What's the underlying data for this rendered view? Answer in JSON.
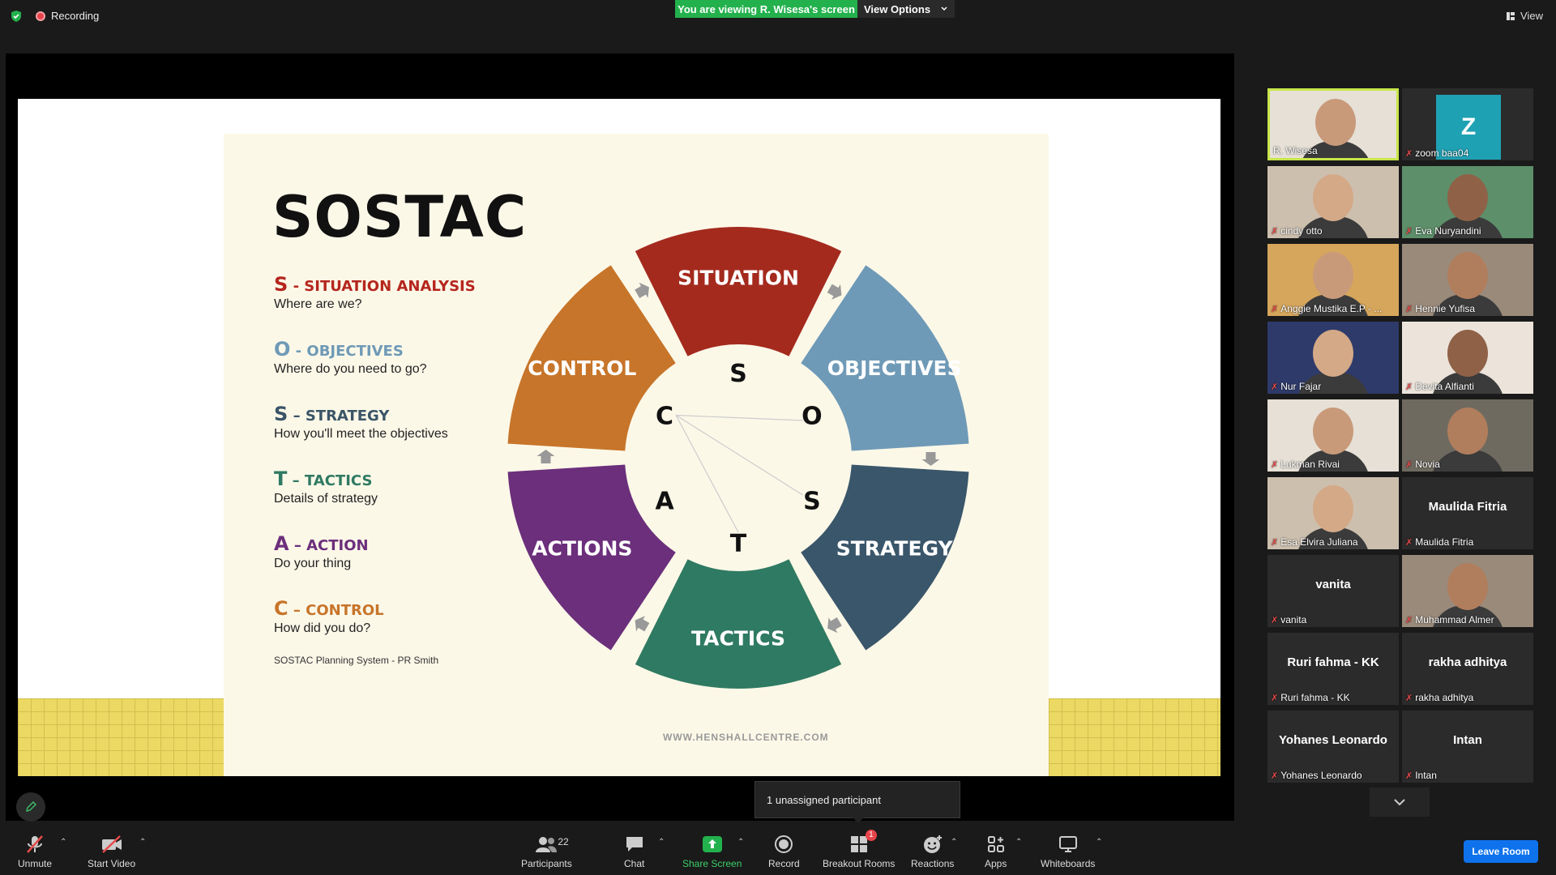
{
  "top": {
    "recording": "Recording",
    "viewing": "You are viewing R. Wisesa's screen",
    "view_options": "View Options",
    "view": "View"
  },
  "slide": {
    "title": "SOSTAC",
    "legend": [
      {
        "letter": "S",
        "sep": " - ",
        "head": "SITUATION ANALYSIS",
        "sub": "Where are we?",
        "color": "#b5261e"
      },
      {
        "letter": "O",
        "sep": " - ",
        "head": "OBJECTIVES",
        "sub": "Where do you need to go?",
        "color": "#6f9ab7"
      },
      {
        "letter": "S",
        "sep": " – ",
        "head": "STRATEGY",
        "sub": "How you'll meet the objectives",
        "color": "#3b5568"
      },
      {
        "letter": "T",
        "sep": " – ",
        "head": "TACTICS",
        "sub": "Details of strategy",
        "color": "#2f7a62"
      },
      {
        "letter": "A",
        "sep": " – ",
        "head": "ACTION",
        "sub": "Do your thing",
        "color": "#6b2f7b"
      },
      {
        "letter": "C",
        "sep": " – ",
        "head": "CONTROL",
        "sub": "How did you do?",
        "color": "#c7752a"
      }
    ],
    "credit": "SOSTAC Planning System - PR Smith",
    "website": "WWW.HENSHALLCENTRE.COM",
    "wheel": {
      "segments": [
        {
          "label": "SITUATION",
          "color": "#a42a1e"
        },
        {
          "label": "OBJECTIVES",
          "color": "#6f9ab7"
        },
        {
          "label": "STRATEGY",
          "color": "#3a566a"
        },
        {
          "label": "TACTICS",
          "color": "#2f7a62"
        },
        {
          "label": "ACTIONS",
          "color": "#6b2f7b"
        },
        {
          "label": "CONTROL",
          "color": "#c7752a"
        }
      ],
      "inner_letters": [
        "S",
        "O",
        "S",
        "T",
        "A",
        "C"
      ]
    }
  },
  "unassigned": "1 unassigned participant",
  "participants": [
    {
      "name": "R. Wisesa",
      "type": "video",
      "active": true
    },
    {
      "name": "zoom baa04",
      "type": "avatar",
      "initial": "Z"
    },
    {
      "name": "cindy otto",
      "type": "video"
    },
    {
      "name": "Eva Nuryandini",
      "type": "video"
    },
    {
      "name": "Anggie Mustika E.P - ...",
      "type": "video"
    },
    {
      "name": "Hennie Yufisa",
      "type": "video"
    },
    {
      "name": "Nur Fajar",
      "type": "video"
    },
    {
      "name": "Devita Alfianti",
      "type": "video"
    },
    {
      "name": "Lukman Rivai",
      "type": "video"
    },
    {
      "name": "Novia",
      "type": "video"
    },
    {
      "name": "Esa Elvira Juliana",
      "type": "video"
    },
    {
      "name": "Maulida Fitria",
      "type": "name"
    },
    {
      "name": "vanita",
      "type": "name"
    },
    {
      "name": "Muhammad Almer",
      "type": "video"
    },
    {
      "name": "Ruri fahma - KK",
      "type": "name"
    },
    {
      "name": "rakha adhitya",
      "type": "name"
    },
    {
      "name": "Yohanes Leonardo",
      "type": "name"
    },
    {
      "name": "Intan",
      "type": "name"
    }
  ],
  "toolbar": {
    "unmute": "Unmute",
    "start_video": "Start Video",
    "participants": "Participants",
    "participants_count": "22",
    "chat": "Chat",
    "share_screen": "Share Screen",
    "record": "Record",
    "breakout_rooms": "Breakout Rooms",
    "breakout_badge": "1",
    "reactions": "Reactions",
    "apps": "Apps",
    "whiteboards": "Whiteboards",
    "leave_room": "Leave Room"
  }
}
